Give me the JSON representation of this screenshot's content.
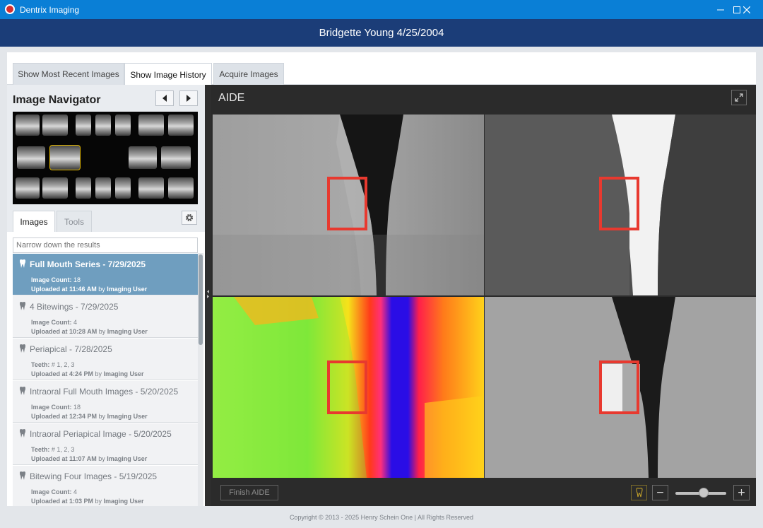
{
  "window": {
    "title": "Dentrix Imaging",
    "icon": "dentrix-logo-icon",
    "controls": [
      "minimize-icon",
      "maximize-icon",
      "close-icon"
    ]
  },
  "patient": {
    "header": "Bridgette Young 4/25/2004"
  },
  "top_tabs": [
    {
      "label": "Show Most Recent Images",
      "active": false
    },
    {
      "label": "Show Image History",
      "active": true
    },
    {
      "label": "Acquire Images",
      "active": false
    }
  ],
  "navigator": {
    "title": "Image Navigator",
    "prev_icon": "caret-left-icon",
    "next_icon": "caret-right-icon",
    "selected_thumbnail": 1
  },
  "side_tabs": [
    {
      "label": "Images",
      "active": true
    },
    {
      "label": "Tools",
      "active": false
    }
  ],
  "search": {
    "placeholder": "Narrow down the results"
  },
  "series": [
    {
      "title": "Full Mouth Series - 7/29/2025",
      "l1_label": "Image Count:",
      "l1_value": " 18",
      "l2_label": "Uploaded at ",
      "l2_time": "11:46 AM",
      "l2_by": " by ",
      "l2_user": "Imaging User",
      "selected": true
    },
    {
      "title": "4 Bitewings - 7/29/2025",
      "l1_label": "Image Count:",
      "l1_value": " 4",
      "l2_label": "Uploaded at ",
      "l2_time": "10:28 AM",
      "l2_by": " by ",
      "l2_user": "Imaging User",
      "selected": false
    },
    {
      "title": "Periapical - 7/28/2025",
      "l1_label": "Teeth:",
      "l1_value": " # 1, 2, 3",
      "l2_label": "Uploaded at ",
      "l2_time": "4:24 PM",
      "l2_by": " by ",
      "l2_user": "Imaging User",
      "selected": false
    },
    {
      "title": "Intraoral Full Mouth Images - 5/20/2025",
      "l1_label": "Image Count:",
      "l1_value": " 18",
      "l2_label": "Uploaded at ",
      "l2_time": "12:34 PM",
      "l2_by": " by ",
      "l2_user": "Imaging User",
      "selected": false
    },
    {
      "title": "Intraoral Periapical Image - 5/20/2025",
      "l1_label": "Teeth:",
      "l1_value": " # 1, 2, 3",
      "l2_label": "Uploaded at ",
      "l2_time": "11:07 AM",
      "l2_by": " by ",
      "l2_user": "Imaging User",
      "selected": false
    },
    {
      "title": "Bitewing Four Images - 5/19/2025",
      "l1_label": "Image Count:",
      "l1_value": " 4",
      "l2_label": "Uploaded at ",
      "l2_time": "1:03 PM",
      "l2_by": " by ",
      "l2_user": "Imaging User",
      "selected": false
    }
  ],
  "viewer": {
    "title": "AIDE",
    "finish_label": "Finish AIDE",
    "zoom_out_label": "−",
    "zoom_in_label": "+",
    "zoom_level": 0.55,
    "marker_color": "#e8392f"
  },
  "footer": {
    "copyright": "Copyright © 2013 - 2025 Henry Schein One | All Rights Reserved"
  }
}
